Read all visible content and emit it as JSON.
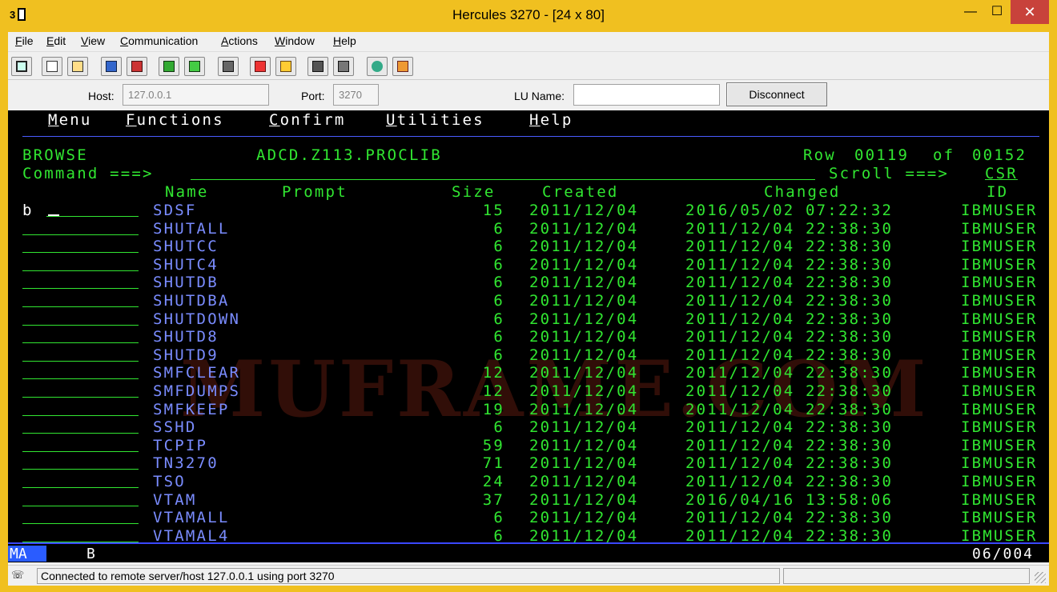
{
  "window": {
    "title": "Hercules 3270 - [24 x 80]",
    "min_glyph": "—",
    "max_glyph": "☐",
    "close_glyph": "✕"
  },
  "menubar": {
    "items": [
      {
        "label": "File",
        "accel": "F"
      },
      {
        "label": "Edit",
        "accel": "E"
      },
      {
        "label": "View",
        "accel": "V"
      },
      {
        "label": "Communication",
        "accel": "C"
      },
      {
        "label": "Actions",
        "accel": "A"
      },
      {
        "label": "Window",
        "accel": "W"
      },
      {
        "label": "Help",
        "accel": "H"
      }
    ]
  },
  "toolbar": {
    "icons": [
      "screen-icon",
      "copy-icon",
      "paste-icon",
      "send-icon",
      "receive-icon",
      "macro-icon",
      "record-icon",
      "print-icon",
      "color-icon",
      "font-icon",
      "keyboard-icon",
      "keymap-icon",
      "globe-icon",
      "script-icon"
    ]
  },
  "connection": {
    "host_label": "Host:",
    "host_value": "127.0.0.1",
    "port_label": "Port:",
    "port_value": "3270",
    "lu_label": "LU Name:",
    "lu_value": "",
    "disconnect_label": "Disconnect"
  },
  "terminal": {
    "menu": [
      "Menu",
      "Functions",
      "Confirm",
      "Utilities",
      "Help"
    ],
    "mode": "BROWSE",
    "dataset": "ADCD.Z113.PROCLIB",
    "row_label": "Row",
    "row_current": "00119",
    "row_of": "of",
    "row_total": "00152",
    "command_label": "Command ===>",
    "scroll_label": "Scroll ===>",
    "scroll_value": "CSR",
    "headers": {
      "name": "Name",
      "prompt": "Prompt",
      "size": "Size",
      "created": "Created",
      "changed": "Changed",
      "id": "ID"
    },
    "first_cmd": "b",
    "rows": [
      {
        "name": "SDSF",
        "size": "15",
        "created": "2011/12/04",
        "changed": "2016/05/02 07:22:32",
        "id": "IBMUSER"
      },
      {
        "name": "SHUTALL",
        "size": "6",
        "created": "2011/12/04",
        "changed": "2011/12/04 22:38:30",
        "id": "IBMUSER"
      },
      {
        "name": "SHUTCC",
        "size": "6",
        "created": "2011/12/04",
        "changed": "2011/12/04 22:38:30",
        "id": "IBMUSER"
      },
      {
        "name": "SHUTC4",
        "size": "6",
        "created": "2011/12/04",
        "changed": "2011/12/04 22:38:30",
        "id": "IBMUSER"
      },
      {
        "name": "SHUTDB",
        "size": "6",
        "created": "2011/12/04",
        "changed": "2011/12/04 22:38:30",
        "id": "IBMUSER"
      },
      {
        "name": "SHUTDBA",
        "size": "6",
        "created": "2011/12/04",
        "changed": "2011/12/04 22:38:30",
        "id": "IBMUSER"
      },
      {
        "name": "SHUTDOWN",
        "size": "6",
        "created": "2011/12/04",
        "changed": "2011/12/04 22:38:30",
        "id": "IBMUSER"
      },
      {
        "name": "SHUTD8",
        "size": "6",
        "created": "2011/12/04",
        "changed": "2011/12/04 22:38:30",
        "id": "IBMUSER"
      },
      {
        "name": "SHUTD9",
        "size": "6",
        "created": "2011/12/04",
        "changed": "2011/12/04 22:38:30",
        "id": "IBMUSER"
      },
      {
        "name": "SMFCLEAR",
        "size": "12",
        "created": "2011/12/04",
        "changed": "2011/12/04 22:38:30",
        "id": "IBMUSER"
      },
      {
        "name": "SMFDUMPS",
        "size": "12",
        "created": "2011/12/04",
        "changed": "2011/12/04 22:38:30",
        "id": "IBMUSER"
      },
      {
        "name": "SMFKEEP",
        "size": "19",
        "created": "2011/12/04",
        "changed": "2011/12/04 22:38:30",
        "id": "IBMUSER"
      },
      {
        "name": "SSHD",
        "size": "6",
        "created": "2011/12/04",
        "changed": "2011/12/04 22:38:30",
        "id": "IBMUSER"
      },
      {
        "name": "TCPIP",
        "size": "59",
        "created": "2011/12/04",
        "changed": "2011/12/04 22:38:30",
        "id": "IBMUSER"
      },
      {
        "name": "TN3270",
        "size": "71",
        "created": "2011/12/04",
        "changed": "2011/12/04 22:38:30",
        "id": "IBMUSER"
      },
      {
        "name": "TSO",
        "size": "24",
        "created": "2011/12/04",
        "changed": "2011/12/04 22:38:30",
        "id": "IBMUSER"
      },
      {
        "name": "VTAM",
        "size": "37",
        "created": "2011/12/04",
        "changed": "2016/04/16 13:58:06",
        "id": "IBMUSER"
      },
      {
        "name": "VTAMALL",
        "size": "6",
        "created": "2011/12/04",
        "changed": "2011/12/04 22:38:30",
        "id": "IBMUSER"
      },
      {
        "name": "VTAMAL4",
        "size": "6",
        "created": "2011/12/04",
        "changed": "2011/12/04 22:38:30",
        "id": "IBMUSER"
      }
    ],
    "watermark": "MUFRAME.COM"
  },
  "oia": {
    "mode": "MA",
    "indicator": "B",
    "cursor_pos": "06/004"
  },
  "status": {
    "text": "Connected to remote server/host 127.0.0.1 using port 3270"
  },
  "colors": {
    "terminal_bg": "#000000",
    "field_green": "#31e631",
    "name_blue": "#7a8cff",
    "titlebar": "#f0c020"
  }
}
